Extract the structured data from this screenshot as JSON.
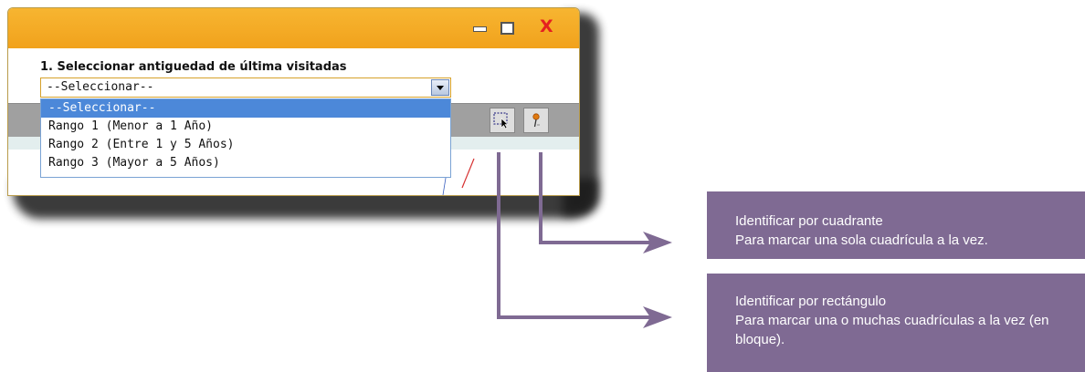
{
  "window": {
    "title_buttons": {
      "minimize": "minimize-icon",
      "maximize": "maximize-icon",
      "close": "X"
    }
  },
  "filter": {
    "label": "1. Seleccionar antiguedad de última visitadas",
    "selected_value": "--Seleccionar--",
    "options": [
      "--Seleccionar--",
      "Rango 1 (Menor a 1 Año)",
      "Rango 2 (Entre 1 y 5 Años)",
      "Rango 3 (Mayor a 5 Años)"
    ],
    "highlighted_option_index": 0
  },
  "tools": [
    {
      "name": "identify-rectangle",
      "icon": "select-rectangle-icon"
    },
    {
      "name": "identify-quadrant",
      "icon": "pin-icon"
    }
  ],
  "callouts": {
    "quadrant": {
      "title": "Identificar por cuadrante",
      "text": "Para marcar una sola cuadrícula a la vez."
    },
    "rectangle": {
      "title": "Identificar por rectángulo",
      "text": "Para marcar una o muchas cuadrículas a la vez (en bloque)."
    }
  },
  "colors": {
    "titlebar": "#f4aa24",
    "close": "#e52020",
    "callout_bg": "#7f6a93",
    "connector": "#7f6a93",
    "dropdown_highlight": "#4c88d9"
  }
}
